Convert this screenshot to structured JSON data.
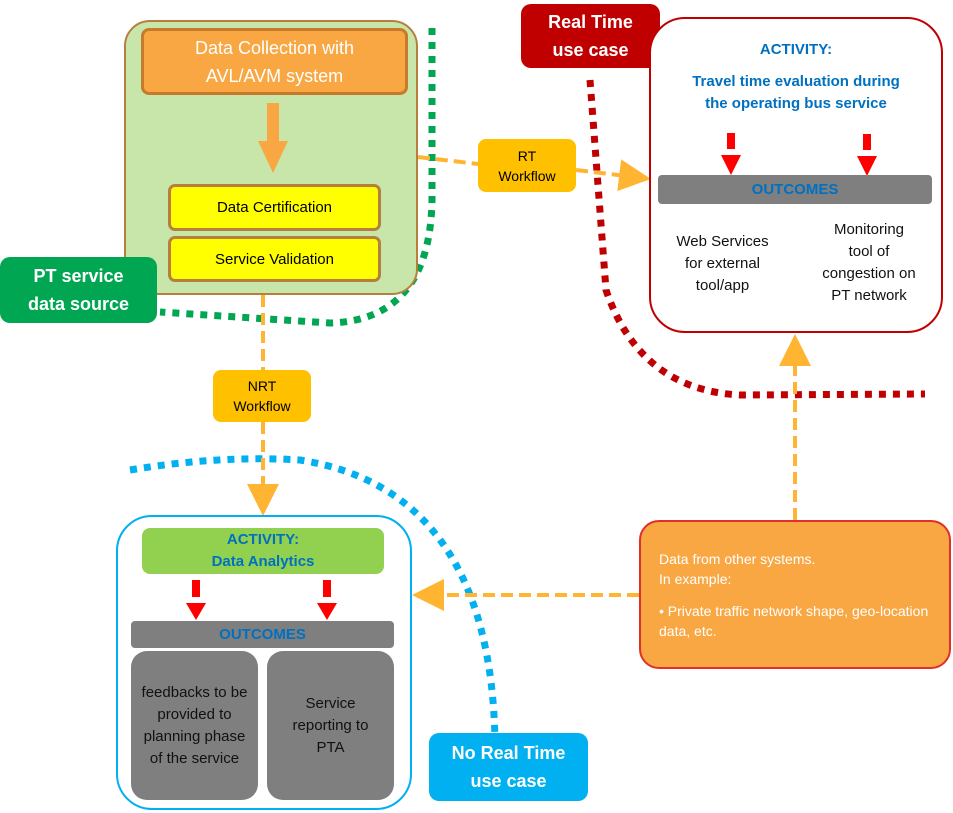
{
  "source": {
    "data_collection": "Data Collection with AVL/AVM system",
    "certification": "Data Certification",
    "validation": "Service Validation",
    "label": "PT service data source"
  },
  "rt": {
    "label": "Real Time use case",
    "workflow": "RT Workflow",
    "activity_title": "ACTIVITY:",
    "activity": "Travel time evaluation during the operating bus service",
    "outcomes": "OUTCOMES",
    "outcome_1": "Web Services for external tool/app",
    "outcome_2": "Monitoring tool of congestion on PT network"
  },
  "nrt": {
    "label": "No Real Time use case",
    "workflow": "NRT Workflow",
    "activity_title": "ACTIVITY:",
    "activity": "Data Analytics",
    "outcomes": "OUTCOMES",
    "outcome_1": "feedbacks to be provided to planning phase of the service",
    "outcome_2": "Service reporting to PTA"
  },
  "other": {
    "line1": "Data from other systems.",
    "line2": "In example:",
    "bullet": "•   Private traffic network shape, geo-location data, etc."
  },
  "colors": {
    "green": "#00a651",
    "dark_red": "#c00000",
    "blue": "#00b0f0",
    "orange": "#f9a743",
    "yellow": "#ffff00",
    "workflow": "#ffc000"
  }
}
